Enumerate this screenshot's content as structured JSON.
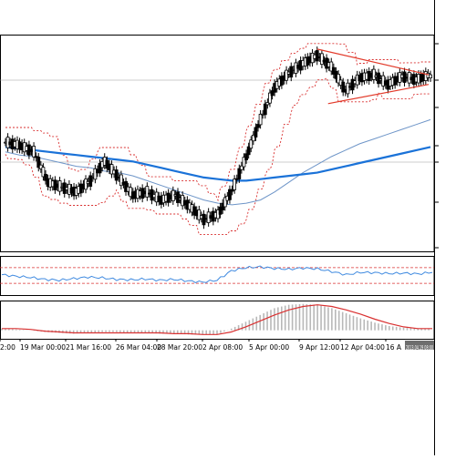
{
  "colors": {
    "candle": "#000000",
    "envelope": "#d93030",
    "ma_fast": "#6e95c8",
    "ma_slow": "#1a72d8",
    "trendline": "#e23a2a",
    "rsi_line": "#3f8ae0",
    "rsi_levels": "#d93030",
    "histogram": "#b8b8b8",
    "signal": "#d93030",
    "frame": "#000000",
    "grid": "#9a9a9a"
  },
  "x_axis": {
    "ticks": [
      "2:00",
      "19 Mar 00:00",
      "21 Mar 16:00",
      "26 Mar 04:00",
      "28 Mar 20:00",
      "2 Apr 08:00",
      "5 Apr 00:00",
      "9 Apr 12:00",
      "12 Apr 04:00",
      "16 A"
    ],
    "current_time_label": "2013.04.19 08:00"
  },
  "chart_data": [
    {
      "type": "candlestick",
      "title": "",
      "panel": "price",
      "indicators": [
        "envelope bands",
        "moving average (fast)",
        "moving average (slow)",
        "trendlines"
      ],
      "x": [
        "2:00",
        "19 Mar 00:00",
        "21 Mar 16:00",
        "26 Mar 04:00",
        "28 Mar 20:00",
        "2 Apr 08:00",
        "5 Apr 00:00",
        "9 Apr 12:00",
        "12 Apr 04:00",
        "16 A"
      ],
      "close": [
        0.88,
        0.86,
        0.82,
        0.63,
        0.6,
        0.57,
        0.64,
        0.76,
        0.66,
        0.55,
        0.57,
        0.52,
        0.55,
        0.48,
        0.4,
        0.43,
        0.58,
        0.79,
        1.02,
        1.22,
        1.31,
        1.37,
        1.42,
        1.35,
        1.2,
        1.28,
        1.3,
        1.24,
        1.29,
        1.27,
        1.3
      ],
      "ma_fast": [
        0.82,
        0.8,
        0.79,
        0.77,
        0.75,
        0.73,
        0.72,
        0.7,
        0.69,
        0.67,
        0.64,
        0.61,
        0.58,
        0.55,
        0.52,
        0.5,
        0.49,
        0.5,
        0.52,
        0.57,
        0.63,
        0.69,
        0.74,
        0.79,
        0.83,
        0.87,
        0.9,
        0.93,
        0.96,
        0.99,
        1.02
      ],
      "ma_slow": [
        0.85,
        0.84,
        0.83,
        0.82,
        0.81,
        0.8,
        0.79,
        0.78,
        0.77,
        0.76,
        0.74,
        0.72,
        0.7,
        0.68,
        0.66,
        0.65,
        0.64,
        0.64,
        0.65,
        0.66,
        0.67,
        0.68,
        0.69,
        0.71,
        0.73,
        0.75,
        0.77,
        0.79,
        0.81,
        0.83,
        0.85
      ]
    },
    {
      "type": "line",
      "panel": "oscillator",
      "title": "",
      "levels": [
        70,
        30
      ],
      "values": [
        52,
        48,
        45,
        40,
        38,
        42,
        46,
        44,
        40,
        39,
        41,
        38,
        40,
        36,
        33,
        38,
        62,
        70,
        72,
        68,
        66,
        69,
        67,
        60,
        52,
        58,
        57,
        55,
        56,
        54,
        58
      ],
      "ylim": [
        0,
        100
      ]
    },
    {
      "type": "bar",
      "panel": "histogram",
      "title": "",
      "values": [
        0.02,
        0.01,
        0.0,
        -0.02,
        -0.03,
        -0.04,
        -0.03,
        -0.02,
        -0.02,
        -0.03,
        -0.03,
        -0.04,
        -0.04,
        -0.05,
        -0.05,
        -0.05,
        0.02,
        0.1,
        0.18,
        0.26,
        0.3,
        0.31,
        0.3,
        0.26,
        0.2,
        0.14,
        0.09,
        0.05,
        0.03,
        0.02,
        0.02
      ],
      "signal": [
        0.02,
        0.02,
        0.01,
        -0.01,
        -0.02,
        -0.03,
        -0.03,
        -0.03,
        -0.03,
        -0.03,
        -0.03,
        -0.03,
        -0.04,
        -0.04,
        -0.05,
        -0.05,
        -0.02,
        0.04,
        0.11,
        0.18,
        0.24,
        0.28,
        0.3,
        0.28,
        0.24,
        0.19,
        0.13,
        0.08,
        0.04,
        0.02,
        0.02
      ],
      "ylim": [
        -0.1,
        0.35
      ]
    }
  ]
}
